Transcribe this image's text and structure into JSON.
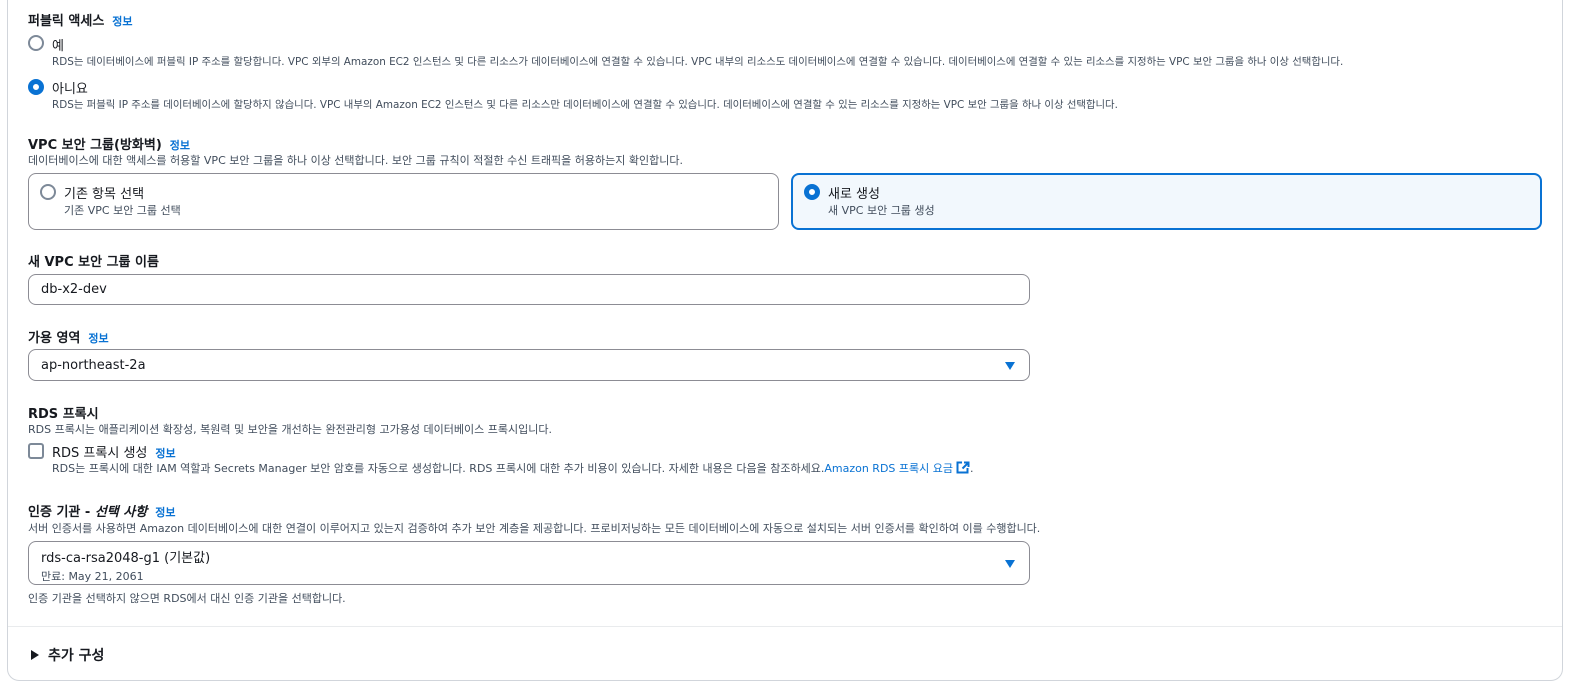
{
  "public_access": {
    "title": "퍼블릭 액세스",
    "info": "정보",
    "options": [
      {
        "label": "예",
        "desc": "RDS는 데이터베이스에 퍼블릭 IP 주소를 할당합니다. VPC 외부의 Amazon EC2 인스턴스 및 다른 리소스가 데이터베이스에 연결할 수 있습니다. VPC 내부의 리소스도 데이터베이스에 연결할 수 있습니다. 데이터베이스에 연결할 수 있는 리소스를 지정하는 VPC 보안 그룹을 하나 이상 선택합니다.",
        "selected": false
      },
      {
        "label": "아니요",
        "desc": "RDS는 퍼블릭 IP 주소를 데이터베이스에 할당하지 않습니다. VPC 내부의 Amazon EC2 인스턴스 및 다른 리소스만 데이터베이스에 연결할 수 있습니다. 데이터베이스에 연결할 수 있는 리소스를 지정하는 VPC 보안 그룹을 하나 이상 선택합니다.",
        "selected": true
      }
    ]
  },
  "vpc_sg": {
    "title": "VPC 보안 그룹(방화벽)",
    "info": "정보",
    "desc": "데이터베이스에 대한 액세스를 허용할 VPC 보안 그룹을 하나 이상 선택합니다. 보안 그룹 규칙이 적절한 수신 트래픽을 허용하는지 확인합니다.",
    "options": [
      {
        "label": "기존 항목 선택",
        "desc": "기존 VPC 보안 그룹 선택",
        "selected": false
      },
      {
        "label": "새로 생성",
        "desc": "새 VPC 보안 그룹 생성",
        "selected": true
      }
    ]
  },
  "new_sg_name": {
    "title": "새 VPC 보안 그룹 이름",
    "value": "db-x2-dev"
  },
  "az": {
    "title": "가용 영역",
    "info": "정보",
    "value": "ap-northeast-2a"
  },
  "rds_proxy": {
    "title": "RDS 프록시",
    "desc": "RDS 프록시는 애플리케이션 확장성, 복원력 및 보안을 개선하는 완전관리형 고가용성 데이터베이스 프록시입니다.",
    "checkbox_label": "RDS 프록시 생성",
    "info": "정보",
    "checkbox_desc": "RDS는 프록시에 대한 IAM 역할과 Secrets Manager 보안 암호를 자동으로 생성합니다. RDS 프록시에 대한 추가 비용이 있습니다. 자세한 내용은 다음을 참조하세요.",
    "link": "Amazon RDS 프록시 요금",
    "period": ".",
    "checked": false
  },
  "ca": {
    "title_prefix": "인증 기관 - ",
    "title_italic": "선택 사항",
    "info": "정보",
    "desc": "서버 인증서를 사용하면 Amazon 데이터베이스에 대한 연결이 이루어지고 있는지 검증하여 추가 보안 계층을 제공합니다. 프로비저닝하는 모든 데이터베이스에 자동으로 설치되는 서버 인증서를 확인하여 이를 수행합니다.",
    "value": "rds-ca-rsa2048-g1 (기본값)",
    "sub": "만료: May 21, 2061",
    "hint": "인증 기관을 선택하지 않으면 RDS에서 대신 인증 기관을 선택합니다."
  },
  "additional": {
    "label": "추가 구성"
  },
  "colors": {
    "accent": "#0972d3",
    "text": "#16191f",
    "muted": "#414d5c",
    "selected_bg": "#f2f8fd"
  }
}
